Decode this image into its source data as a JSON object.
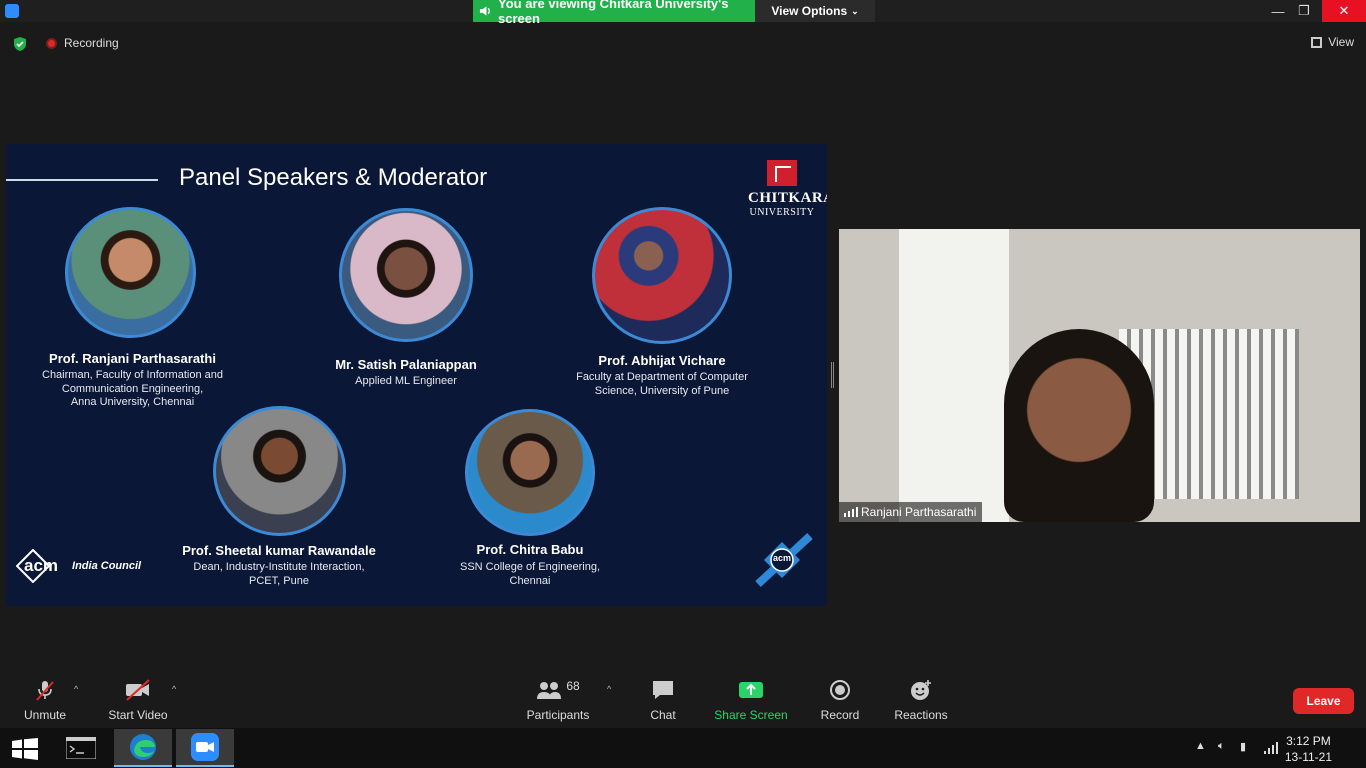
{
  "titlebar": {
    "banner_text": "You are viewing Chitkara University's screen",
    "view_options_label": "View Options",
    "minimize_glyph": "—",
    "restore_glyph": "❐",
    "close_glyph": "✕"
  },
  "topbar": {
    "recording_label": "Recording",
    "view_label": "View"
  },
  "slide": {
    "title": "Panel Speakers & Moderator",
    "logo": {
      "name": "CHITKARA",
      "sub": "UNIVERSITY"
    },
    "speakers": [
      {
        "name": "Prof. Ranjani Parthasarathi",
        "desc": [
          "Chairman, Faculty of Information and",
          "Communication Engineering,",
          "Anna University, Chennai"
        ]
      },
      {
        "name": "Mr. Satish Palaniappan",
        "desc": [
          "Applied ML Engineer"
        ]
      },
      {
        "name": "Prof. Abhijat Vichare",
        "desc": [
          "Faculty at Department of Computer",
          "Science, University of Pune"
        ]
      },
      {
        "name": "Prof. Sheetal kumar Rawandale",
        "desc": [
          "Dean, Industry-Institute Interaction,",
          "PCET, Pune"
        ]
      },
      {
        "name": "Prof. Chitra Babu",
        "desc": [
          "SSN College of Engineering,",
          "Chennai"
        ]
      }
    ],
    "acm_left": {
      "word": "acm",
      "council": "India Council"
    },
    "acm_right": "acm"
  },
  "video": {
    "participant_name": "Ranjani Parthasarathi"
  },
  "toolbar": {
    "unmute": "Unmute",
    "start_video": "Start Video",
    "participants": "Participants",
    "participant_count": "68",
    "chat": "Chat",
    "share_screen": "Share Screen",
    "record": "Record",
    "reactions": "Reactions",
    "leave": "Leave"
  },
  "taskbar": {
    "time": "3:12 PM",
    "date": "13-11-21"
  },
  "colors": {
    "banner_green": "#22b04b",
    "leave_red": "#e02828",
    "slide_navy": "#0b1736",
    "share_green": "#2bd46a"
  }
}
